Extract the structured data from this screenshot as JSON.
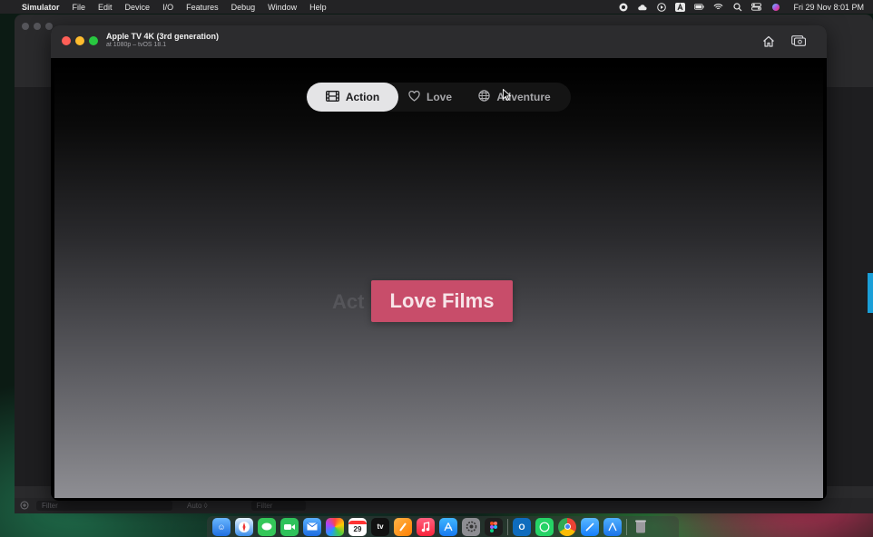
{
  "menubar": {
    "app_name": "Simulator",
    "menus": [
      "File",
      "Edit",
      "Device",
      "I/O",
      "Features",
      "Debug",
      "Window",
      "Help"
    ],
    "clock": "Fri 29 Nov  8:01 PM"
  },
  "simulator": {
    "title": "Apple TV 4K (3rd generation)",
    "subtitle": "at 1080p – tvOS 18.1"
  },
  "tabs": [
    {
      "label": "Action",
      "icon": "film-icon",
      "selected": true
    },
    {
      "label": "Love",
      "icon": "heart-icon",
      "selected": false
    },
    {
      "label": "Adventure",
      "icon": "globe-icon",
      "selected": false
    }
  ],
  "content": {
    "ghost_label": "Act",
    "card_label": "Love Films"
  },
  "xcode_bottom": {
    "filter_placeholder": "Filter",
    "auto_label": "Auto ◊",
    "filter2_placeholder": "Filter"
  },
  "dock": {
    "calendar_day": "29",
    "tv_label": "tv"
  },
  "colors": {
    "card": "#c84d6a",
    "tab_selected_bg": "#e4e4e6",
    "tabbar_bg": "#141414"
  }
}
